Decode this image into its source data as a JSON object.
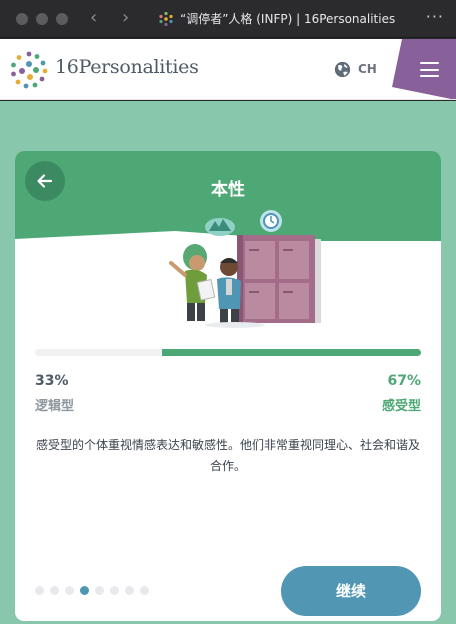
{
  "browser": {
    "tab_title": "“调停者”人格 (INFP) | 16Personalities",
    "back_icon": "chevron-left",
    "forward_icon": "chevron-right",
    "more_icon": "ellipsis"
  },
  "header": {
    "logo_text": "16Personalities",
    "language_label": "CH",
    "menu_icon": "hamburger-icon",
    "accent": "#88619a"
  },
  "card": {
    "title": "本性",
    "left_percent": "33%",
    "left_label": "逻辑型",
    "right_percent": "67%",
    "right_label": "感受型",
    "right_fraction": 0.67,
    "description": "感受型的个体重视情感表达和敏感性。他们非常重视同理心、社会和谐及合作。",
    "continue_label": "继续",
    "steps": 8,
    "active_step": 4,
    "colors": {
      "header_green": "#4ea876",
      "page_green": "#88c7ac",
      "button_blue": "#5197b4"
    }
  }
}
